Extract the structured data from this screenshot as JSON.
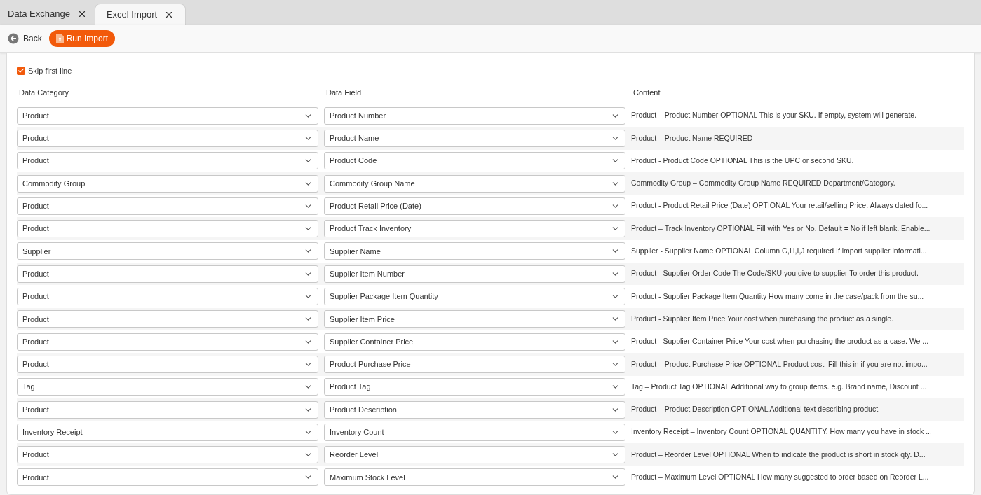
{
  "tabs": [
    {
      "label": "Data Exchange",
      "selected": false
    },
    {
      "label": "Excel Import",
      "selected": true
    }
  ],
  "toolbar": {
    "back": "Back",
    "run": "Run Import"
  },
  "skip_first_line": {
    "label": "Skip first line",
    "checked": true
  },
  "columns": [
    "Data Category",
    "Data Field",
    "Content"
  ],
  "rows": [
    {
      "category": "Product",
      "field": "Product Number",
      "content": "Product – Product Number OPTIONAL This is your SKU. If empty, system will generate."
    },
    {
      "category": "Product",
      "field": "Product Name",
      "content": "Product – Product Name REQUIRED"
    },
    {
      "category": "Product",
      "field": "Product Code",
      "content": "Product - Product Code OPTIONAL This is the UPC or second SKU."
    },
    {
      "category": "Commodity Group",
      "field": "Commodity Group Name",
      "content": "Commodity Group – Commodity Group Name REQUIRED Department/Category."
    },
    {
      "category": "Product",
      "field": "Product Retail Price (Date)",
      "content": "Product - Product Retail Price (Date) OPTIONAL Your retail/selling Price. Always dated fo..."
    },
    {
      "category": "Product",
      "field": "Product Track Inventory",
      "content": "Product – Track Inventory OPTIONAL Fill with Yes or No. Default = No if left blank. Enable..."
    },
    {
      "category": "Supplier",
      "field": "Supplier Name",
      "content": "Supplier - Supplier Name OPTIONAL Column G,H,I,J required If import supplier informati..."
    },
    {
      "category": "Product",
      "field": "Supplier Item Number",
      "content": "Product - Supplier Order Code The Code/SKU you give to supplier To order this product."
    },
    {
      "category": "Product",
      "field": "Supplier Package Item Quantity",
      "content": "Product - Supplier Package Item Quantity How many come in the case/pack from the su..."
    },
    {
      "category": "Product",
      "field": "Supplier Item Price",
      "content": "Product - Supplier Item Price Your cost when purchasing the product as a single."
    },
    {
      "category": "Product",
      "field": "Supplier Container Price",
      "content": "Product - Supplier Container Price Your cost when purchasing the product as a case. We ..."
    },
    {
      "category": "Product",
      "field": "Product Purchase Price",
      "content": "Product – Product Purchase Price OPTIONAL Product cost. Fill this in if you are not impo..."
    },
    {
      "category": "Tag",
      "field": "Product Tag",
      "content": "Tag – Product Tag OPTIONAL Additional way to group items. e.g. Brand name, Discount ..."
    },
    {
      "category": "Product",
      "field": "Product Description",
      "content": "Product – Product Description OPTIONAL Additional text describing product."
    },
    {
      "category": "Inventory Receipt",
      "field": "Inventory Count",
      "content": "Inventory Receipt – Inventory Count OPTIONAL QUANTITY. How many you have in stock ..."
    },
    {
      "category": "Product",
      "field": "Reorder Level",
      "content": "Product – Reorder Level OPTIONAL When to indicate the product is short in stock qty. D..."
    },
    {
      "category": "Product",
      "field": "Maximum Stock Level",
      "content": "Product – Maximum Level OPTIONAL How many suggested to order based on Reorder L..."
    }
  ]
}
